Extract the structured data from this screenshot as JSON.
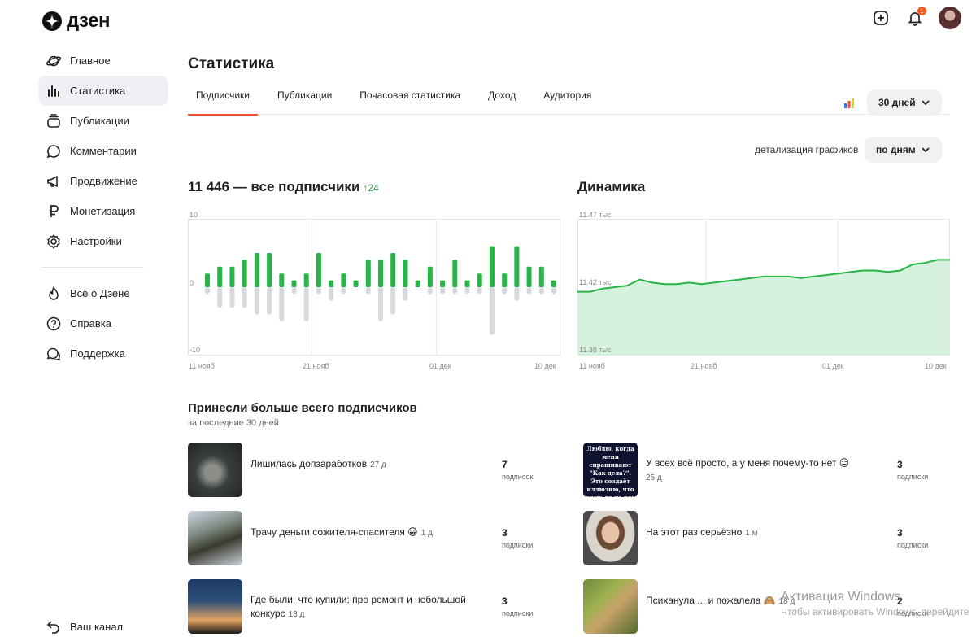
{
  "brand": {
    "name": "дзен",
    "notification_count": "1"
  },
  "sidebar": {
    "items": [
      {
        "label": "Главное",
        "icon": "planet-icon"
      },
      {
        "label": "Статистика",
        "icon": "stats-icon",
        "active": true
      },
      {
        "label": "Публикации",
        "icon": "stack-icon"
      },
      {
        "label": "Комментарии",
        "icon": "comment-icon"
      },
      {
        "label": "Продвижение",
        "icon": "megaphone-icon"
      },
      {
        "label": "Монетизация",
        "icon": "ruble-icon"
      },
      {
        "label": "Настройки",
        "icon": "gear-icon"
      }
    ],
    "secondary": [
      {
        "label": "Всё о Дзене",
        "icon": "flame-icon"
      },
      {
        "label": "Справка",
        "icon": "help-icon"
      },
      {
        "label": "Поддержка",
        "icon": "support-icon"
      }
    ],
    "back_label": "Ваш канал"
  },
  "page": {
    "title": "Статистика"
  },
  "tabs": [
    "Подписчики",
    "Публикации",
    "Почасовая статистика",
    "Доход",
    "Аудитория"
  ],
  "period": "30 дней",
  "detail": {
    "label": "детализация графиков",
    "value": "по дням"
  },
  "colors": {
    "accent": "#f5502a",
    "positive": "#28b446",
    "negative": "#d9d9d9",
    "area": "#d6f2df"
  },
  "chart_data": [
    {
      "type": "bar",
      "title": "11 446 — все подписчики",
      "growth": "24",
      "y_ticks": [
        "10",
        "0",
        "-10"
      ],
      "ylim": [
        -10,
        10
      ],
      "x_ticks": [
        "11 нояб",
        "21 нояб",
        "01 дек",
        "10 дек"
      ],
      "series": [
        {
          "values": [
            2,
            3,
            3,
            4,
            5,
            5,
            2,
            1,
            2,
            5,
            1,
            2,
            1,
            4,
            4,
            5,
            4,
            1,
            3,
            1,
            4,
            1,
            2,
            6,
            2,
            6,
            3,
            3,
            1
          ]
        },
        {
          "values": [
            -1,
            -3,
            -3,
            -3,
            -4,
            -4,
            -5,
            -1,
            -5,
            -1,
            -2,
            -1,
            0,
            -1,
            -5,
            -4,
            -2,
            0,
            -1,
            -1,
            -1,
            -1,
            -1,
            -7,
            -1,
            -2,
            -1,
            -1,
            -1
          ]
        }
      ]
    },
    {
      "type": "area",
      "title": "Динамика",
      "y_ticks": [
        "11.47 тыс",
        "11.42 тыс",
        "11.38 тыс"
      ],
      "ylim": [
        11380,
        11470
      ],
      "x_ticks": [
        "11 нояб",
        "21 нояб",
        "01 дек",
        "10 дек"
      ],
      "values": [
        11422,
        11422,
        11424,
        11425,
        11426,
        11430,
        11428,
        11427,
        11427,
        11428,
        11427,
        11428,
        11429,
        11430,
        11431,
        11432,
        11432,
        11432,
        11431,
        11432,
        11433,
        11434,
        11435,
        11436,
        11436,
        11435,
        11436,
        11440,
        11441,
        11443,
        11443
      ]
    }
  ],
  "top_section": {
    "title": "Принесли больше всего подписчиков",
    "subtitle": "за последние 30 дней"
  },
  "publications": [
    {
      "title": "Лишилась допзаработков",
      "time": "27 д",
      "count": "7",
      "unit": "подписок"
    },
    {
      "title": "У всех всё просто, а у меня почему-то нет 😑",
      "time": "25 д",
      "count": "3",
      "unit": "подписки"
    },
    {
      "title": "Трачу деньги сожителя-спасителя 😁",
      "time": "1 д",
      "count": "3",
      "unit": "подписки"
    },
    {
      "title": "На этот раз серьёзно",
      "time": "1 м",
      "count": "3",
      "unit": "подписки"
    },
    {
      "title": "Где были, что купили: про ремонт и небольшой конкурс",
      "time": "13 д",
      "count": "3",
      "unit": "подписки"
    },
    {
      "title": "Психанула ... и пожалела 🙈",
      "time": "18 д",
      "count": "2",
      "unit": "подписки"
    }
  ],
  "thumb_text": "Люблю, когда меня спрашивают \"Как дела?\". Это создаёт иллюзию, что кому-то не всё равно",
  "watermark": {
    "title": "Активация Windows",
    "sub": "Чтобы активировать Windows, перейдите"
  }
}
